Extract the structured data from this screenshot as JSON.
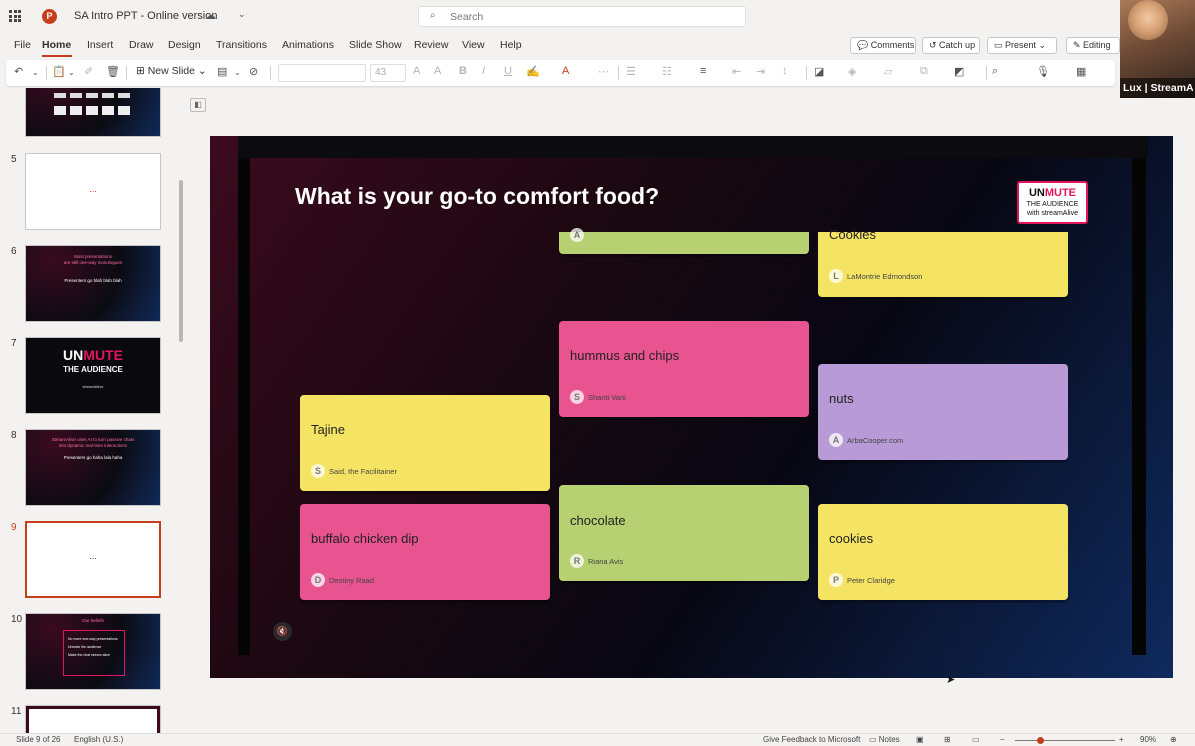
{
  "app": {
    "title": "SA Intro PPT - Online version",
    "search_placeholder": "Search"
  },
  "video": {
    "label": "Lux | StreamA"
  },
  "menu": [
    "File",
    "Home",
    "Insert",
    "Draw",
    "Design",
    "Transitions",
    "Animations",
    "Slide Show",
    "Review",
    "View",
    "Help"
  ],
  "topbuttons": {
    "comments": "Comments",
    "catchup": "Catch up",
    "present": "Present",
    "editing": "Editing"
  },
  "ribbon": {
    "new_slide": "New Slide",
    "font_size": "43"
  },
  "thumbnails": [
    {
      "num": "5"
    },
    {
      "num": "6"
    },
    {
      "num": "7"
    },
    {
      "num": "8"
    },
    {
      "num": "9"
    },
    {
      "num": "10"
    },
    {
      "num": "11"
    }
  ],
  "thumb_text": {
    "t5": "...",
    "t6a": "Most presentations",
    "t6b": "are still one-way monologues",
    "t6c": "Presenters go blah blah blah",
    "t7a": "UN",
    "t7b": "MUTE",
    "t7c": "THE AUDIENCE",
    "t7d": "streamAlive",
    "t8a": "StreamAlive uses AI to turn passive chats",
    "t8b": "into dynamic real-time interactions",
    "t8c": "Presenters go haha lala haha",
    "t9": "...",
    "t10a": "Our beliefs",
    "t10b": "No more one-way presentations",
    "t10c": "Unmute the audience",
    "t10d": "Make the chat stream alive"
  },
  "slide": {
    "title": "What is your go-to comfort food?",
    "logo": {
      "un": "UN",
      "mute": "MUTE",
      "line2": "THE AUDIENCE",
      "line3": "with streamAlive"
    },
    "cards": [
      {
        "text": "",
        "initial": "A",
        "name": "",
        "color": "green"
      },
      {
        "text": "Cookies",
        "initial": "L",
        "name": "LaMontrie Edmondson",
        "color": "yellow"
      },
      {
        "text": "hummus and chips",
        "initial": "S",
        "name": "Shanti Vani",
        "color": "pink"
      },
      {
        "text": "nuts",
        "initial": "A",
        "name": "ArbaCooper.com",
        "color": "purple"
      },
      {
        "text": "Tajine",
        "initial": "S",
        "name": "Said, the Facilitainer",
        "color": "yellow"
      },
      {
        "text": "chocolate",
        "initial": "R",
        "name": "Riana Avis",
        "color": "green"
      },
      {
        "text": "buffalo chicken dip",
        "initial": "D",
        "name": "Destiny Raad",
        "color": "pink"
      },
      {
        "text": "cookies",
        "initial": "P",
        "name": "Peter Claridge",
        "color": "yellow"
      }
    ]
  },
  "status": {
    "slide": "Slide 9 of 26",
    "lang": "English (U.S.)",
    "feedback": "Give Feedback to Microsoft",
    "notes": "Notes",
    "zoom": "90%"
  }
}
